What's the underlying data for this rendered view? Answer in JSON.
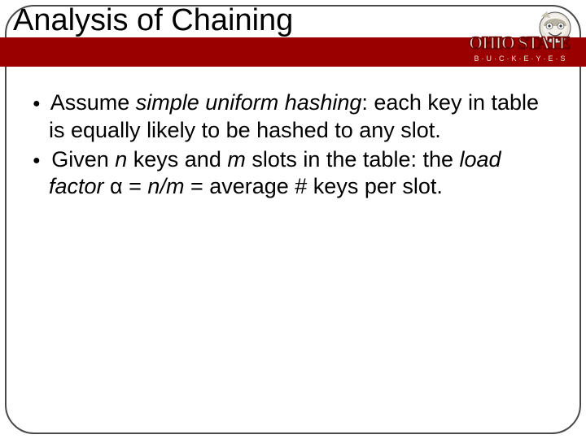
{
  "slide": {
    "title": "Analysis of Chaining",
    "logo": {
      "top_text": "OHIO STATE",
      "sub_text": "B·U·C·K·E·Y·E·S"
    },
    "bullets": [
      {
        "before": "Assume ",
        "italic": "simple uniform hashing",
        "after": ": each key in table is equally likely to be hashed to any slot."
      },
      {
        "before": "Given ",
        "italic1": "n",
        "mid1": " keys and ",
        "italic2": "m",
        "mid2": " slots in the table: the ",
        "italic3": "load factor",
        "mid3": " α = ",
        "italic4": "n/m",
        "after": " = average # keys per slot."
      }
    ]
  }
}
